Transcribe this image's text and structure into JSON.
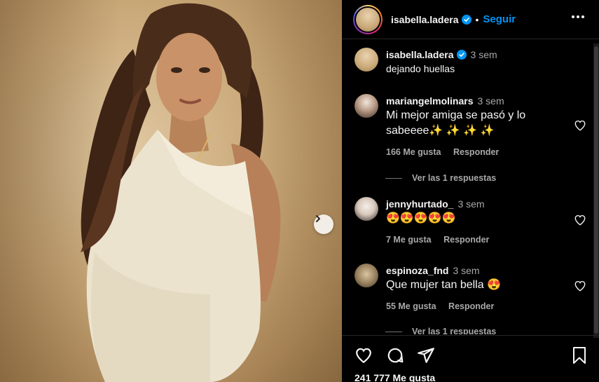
{
  "post": {
    "author": "isabella.ladera",
    "follow_label": "Seguir",
    "separator": "•",
    "likes_text": "241 777 Me gusta"
  },
  "comments": [
    {
      "username": "isabella.ladera",
      "time": "3 sem",
      "text": "dejando huellas",
      "verified": true
    },
    {
      "username": "mariangelmolinars",
      "time": "3 sem",
      "text_line1": "Mi mejor amiga se pasó y lo",
      "text_line2": "sabeeee✨ ✨ ✨ ✨",
      "likes": "166 Me gusta",
      "reply_label": "Responder",
      "view_replies": "Ver las 1 respuestas"
    },
    {
      "username": "jennyhurtado_",
      "time": "3 sem",
      "text": "😍😍😍😍😍",
      "likes": "7 Me gusta",
      "reply_label": "Responder"
    },
    {
      "username": "espinoza_fnd",
      "time": "3 sem",
      "text": "Que mujer tan bella 😍",
      "likes": "55 Me gusta",
      "reply_label": "Responder",
      "view_replies": "Ver las 1 respuestas"
    }
  ],
  "icons": {
    "verified": "verified-badge-icon",
    "more": "more-options-icon",
    "next": "chevron-right-icon",
    "like": "heart-icon",
    "comment": "comment-icon",
    "share": "send-icon",
    "save": "bookmark-icon"
  },
  "colors": {
    "accent": "#0095f6",
    "background": "#000000",
    "muted_text": "#a8a8a8"
  }
}
